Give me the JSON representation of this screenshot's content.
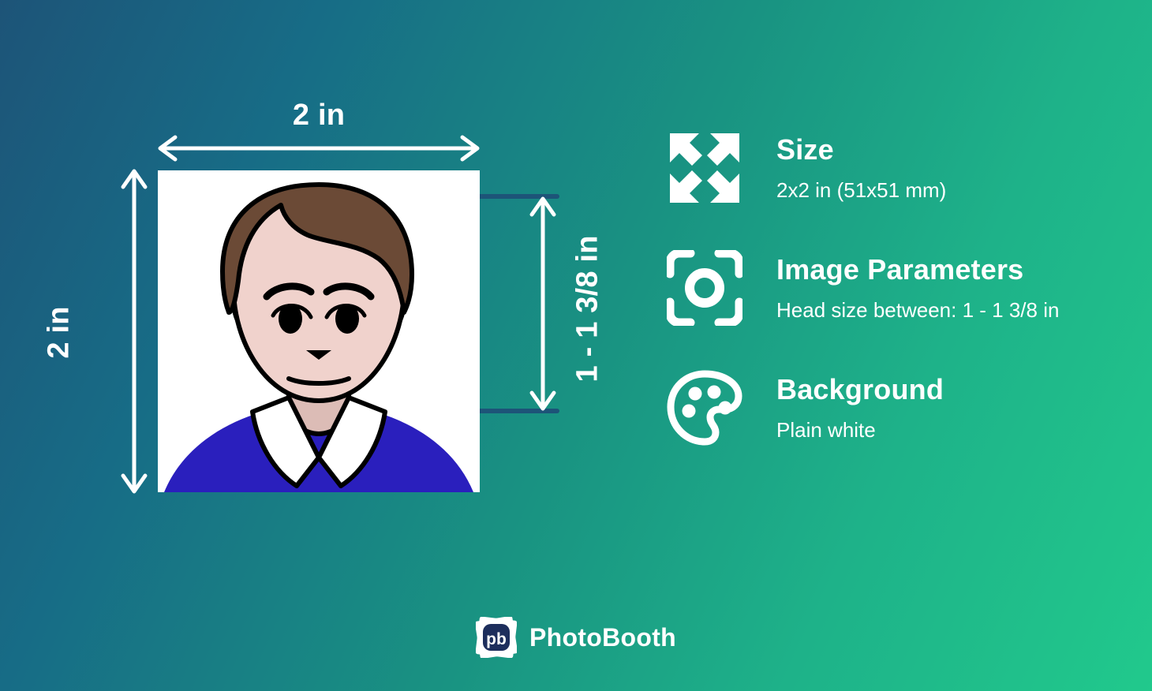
{
  "background": {
    "gradient_from": "#1d5478",
    "gradient_to": "#21c98c"
  },
  "illustration": {
    "width_label": "2 in",
    "height_label": "2 in",
    "head_height_label": "1 - 1 3/8 in",
    "photo_background": "#ffffff",
    "guide_line_color": "#1d5478",
    "colors": {
      "hair": "#6b4a36",
      "skin": "#f0d2cc",
      "neck": "#dcbcb6",
      "shirt": "#2a1fbd",
      "collar": "#ffffff",
      "outline": "#000000"
    }
  },
  "info": {
    "items": [
      {
        "icon": "expand-arrows-icon",
        "title": "Size",
        "value": "2x2 in (51x51 mm)"
      },
      {
        "icon": "viewfinder-icon",
        "title": "Image Parameters",
        "value": "Head size between: 1 - 1 3/8 in"
      },
      {
        "icon": "palette-icon",
        "title": "Background",
        "value": "Plain white"
      }
    ]
  },
  "footer": {
    "logo_monogram": "pb",
    "brand_name": "PhotoBooth",
    "logo_badge_color": "#1d2e5c",
    "logo_frame_color": "#ffffff"
  }
}
